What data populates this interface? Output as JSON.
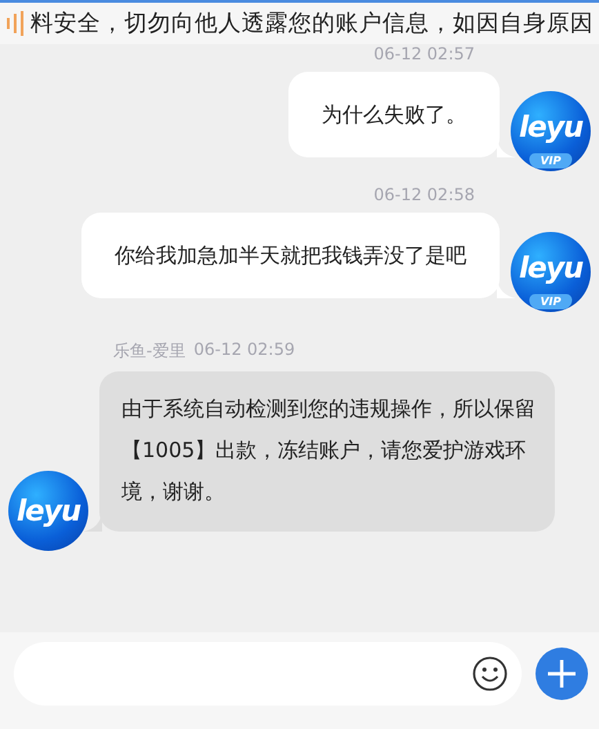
{
  "notice": {
    "text": "料安全，切勿向他人透露您的账户信息，如因自身原因"
  },
  "messages": [
    {
      "kind": "sent",
      "time": "06-12 02:57",
      "text": "为什么失败了。",
      "avatar": {
        "logo": "leyu",
        "badge": "VIP"
      }
    },
    {
      "kind": "sent",
      "time": "06-12 02:58",
      "text": "你给我加急加半天就把我钱弄没了是吧",
      "avatar": {
        "logo": "leyu",
        "badge": "VIP"
      }
    },
    {
      "kind": "received",
      "sender": "乐鱼-爱里",
      "time": "06-12 02:59",
      "text": "由于系统自动检测到您的违规操作，所以保留【1005】出款，冻结账户，请您爱护游戏环境，谢谢。",
      "avatar": {
        "logo": "leyu"
      }
    }
  ]
}
